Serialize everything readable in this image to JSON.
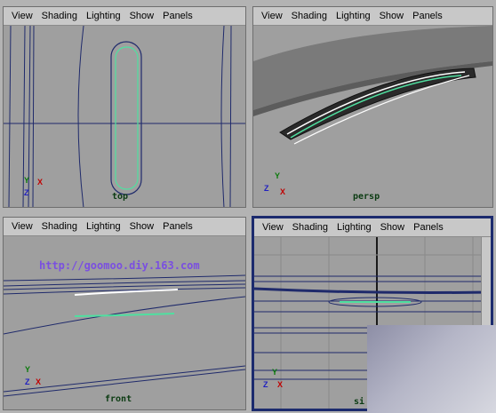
{
  "menu": [
    "View",
    "Shading",
    "Lighting",
    "Show",
    "Panels"
  ],
  "viewports": {
    "top": {
      "label": "top"
    },
    "persp": {
      "label": "persp"
    },
    "front": {
      "label": "front",
      "watermark": "http://goomoo.diy.163.com"
    },
    "side": {
      "label": "si"
    }
  },
  "axes": {
    "x": "X",
    "y": "Y",
    "z": "Z"
  },
  "colors": {
    "viewport_bg": "#9f9f9f",
    "menu_bg": "#c8c8c8",
    "active_border": "#1c2b6e",
    "curve_dark": "#1f2a6b",
    "curve_green": "#4fe0a0",
    "curve_white": "#ffffff",
    "label_green": "#0b3b12",
    "watermark": "#7a4fe0"
  }
}
